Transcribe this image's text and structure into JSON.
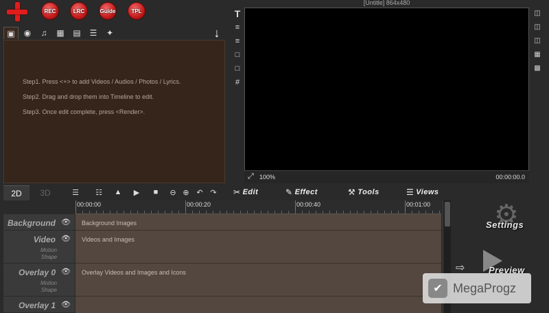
{
  "toolbar": {
    "buttons": [
      "REC",
      "LRC",
      "Guide",
      "TPL"
    ]
  },
  "media": {
    "steps": [
      "Step1. Press <+> to add Videos / Audios / Photos / Lyrics.",
      "Step2. Drag and drop them into Timeline to edit.",
      "Step3. Once edit complete, press <Render>."
    ]
  },
  "preview": {
    "title": "[Untitle] 864x480",
    "zoom": "100%",
    "time": "00:00:00.0"
  },
  "timeline": {
    "tabs": [
      "2D",
      "3D"
    ],
    "menus": [
      "Edit",
      "Effect",
      "Tools",
      "Views"
    ],
    "ruler": [
      "00:00:00",
      "00:00:20",
      "00:00:40",
      "00:01:00"
    ],
    "tracks": [
      {
        "name": "Background",
        "content": "Background Images"
      },
      {
        "name": "Video",
        "sub1": "Motion",
        "sub2": "Shape",
        "content": "Videos and Images"
      },
      {
        "name": "Overlay 0",
        "sub1": "Motion",
        "sub2": "Shape",
        "content": "Overlay Videos and Images and Icons"
      },
      {
        "name": "Overlay 1"
      }
    ]
  },
  "right": {
    "settings": "Settings",
    "preview": "Preview"
  },
  "watermark": "MegaProgz",
  "colors": {
    "accent_red": "#e11c1c",
    "panel": "#35251a",
    "lane": "#54473f"
  }
}
